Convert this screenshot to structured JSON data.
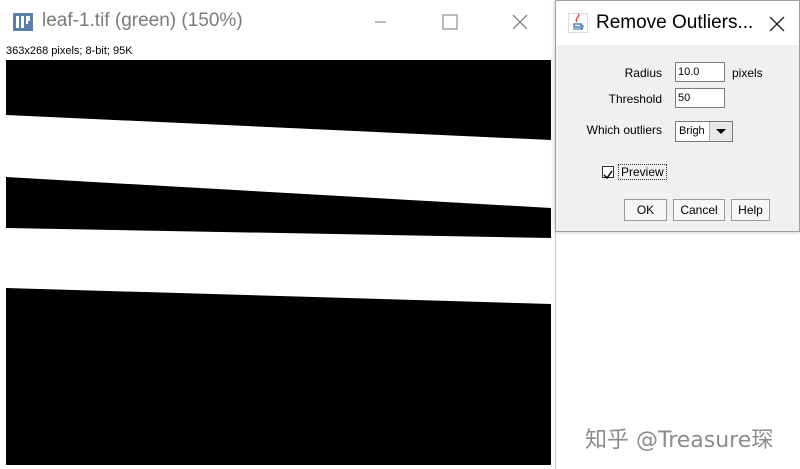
{
  "image_window": {
    "title": "leaf-1.tif (green) (150%)",
    "info": "363x268 pixels; 8-bit; 95K",
    "app_icon": "imagej-icon",
    "controls": [
      "minimize-icon",
      "maximize-icon",
      "close-icon"
    ]
  },
  "dialog": {
    "title": "Remove Outliers...",
    "icon": "java-icon",
    "radius": {
      "label": "Radius",
      "value": "10.0",
      "unit": "pixels"
    },
    "threshold": {
      "label": "Threshold",
      "value": "50"
    },
    "which_outliers": {
      "label": "Which outliers",
      "value": "Brigh"
    },
    "preview": {
      "label": "Preview",
      "checked": true
    },
    "buttons": {
      "ok": "OK",
      "cancel": "Cancel",
      "help": "Help"
    }
  },
  "watermark": "知乎 @Treasure琛"
}
